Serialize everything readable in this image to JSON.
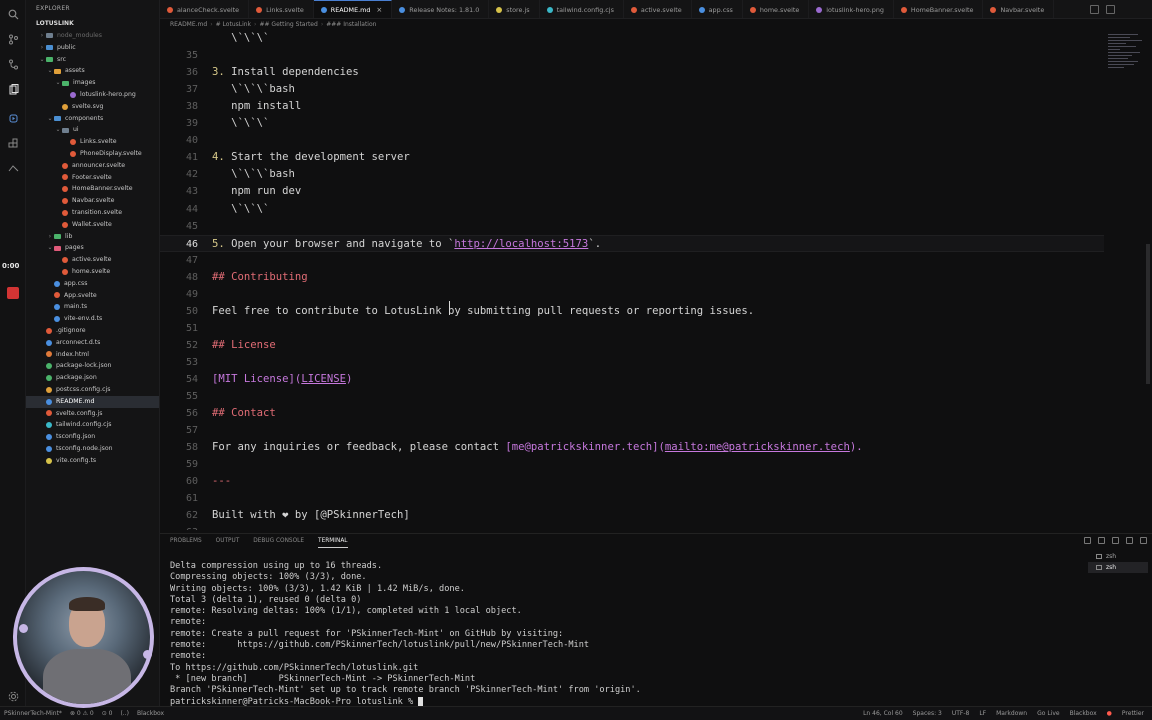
{
  "tabs": [
    {
      "label": "alanceCheck.svelte",
      "color": "#e05a3a",
      "active": false
    },
    {
      "label": "Links.svelte",
      "color": "#e05a3a",
      "active": false
    },
    {
      "label": "README.md",
      "color": "#4a8fe0",
      "active": true
    },
    {
      "label": "Release Notes: 1.81.0",
      "color": "#4a8fe0",
      "active": false
    },
    {
      "label": "store.js",
      "color": "#d6c24a",
      "active": false
    },
    {
      "label": "tailwind.config.cjs",
      "color": "#3ab8c8",
      "active": false
    },
    {
      "label": "active.svelte",
      "color": "#e05a3a",
      "active": false
    },
    {
      "label": "app.css",
      "color": "#4a8fe0",
      "active": false
    },
    {
      "label": "home.svelte",
      "color": "#e05a3a",
      "active": false
    },
    {
      "label": "lotuslink-hero.png",
      "color": "#9a6ad0",
      "active": false
    },
    {
      "label": "HomeBanner.svelte",
      "color": "#e05a3a",
      "active": false
    },
    {
      "label": "Navbar.svelte",
      "color": "#e05a3a",
      "active": false
    }
  ],
  "breadcrumb": [
    "README.md",
    "# LotusLink",
    "## Getting Started",
    "### Installation"
  ],
  "sidebar": {
    "header": "EXPLORER",
    "project": "LOTUSLINK",
    "items": [
      {
        "label": "node_modules",
        "indent": 1,
        "kind": "folder",
        "chev": "›",
        "dim": true,
        "color": "#6f7f8f"
      },
      {
        "label": "public",
        "indent": 1,
        "kind": "folder",
        "chev": "›",
        "color": "#4b8fd1"
      },
      {
        "label": "src",
        "indent": 1,
        "kind": "folder",
        "chev": "⌄",
        "color": "#4bb36a"
      },
      {
        "label": "assets",
        "indent": 2,
        "kind": "folder",
        "chev": "⌄",
        "color": "#e0a03a"
      },
      {
        "label": "images",
        "indent": 3,
        "kind": "folder",
        "chev": "⌄",
        "color": "#4bb36a"
      },
      {
        "label": "lotuslink-hero.png",
        "indent": 4,
        "kind": "file",
        "color": "#9a6ad0"
      },
      {
        "label": "svelte.svg",
        "indent": 3,
        "kind": "file",
        "color": "#e0a03a"
      },
      {
        "label": "components",
        "indent": 2,
        "kind": "folder",
        "chev": "⌄",
        "color": "#4b8fd1"
      },
      {
        "label": "ui",
        "indent": 3,
        "kind": "folder",
        "chev": "⌄",
        "color": "#6f7f8f"
      },
      {
        "label": "Links.svelte",
        "indent": 4,
        "kind": "file",
        "color": "#e05a3a"
      },
      {
        "label": "PhoneDisplay.svelte",
        "indent": 4,
        "kind": "file",
        "color": "#e05a3a"
      },
      {
        "label": "announcer.svelte",
        "indent": 3,
        "kind": "file",
        "color": "#e05a3a"
      },
      {
        "label": "Footer.svelte",
        "indent": 3,
        "kind": "file",
        "color": "#e05a3a"
      },
      {
        "label": "HomeBanner.svelte",
        "indent": 3,
        "kind": "file",
        "color": "#e05a3a"
      },
      {
        "label": "Navbar.svelte",
        "indent": 3,
        "kind": "file",
        "color": "#e05a3a"
      },
      {
        "label": "transition.svelte",
        "indent": 3,
        "kind": "file",
        "color": "#e05a3a"
      },
      {
        "label": "Wallet.svelte",
        "indent": 3,
        "kind": "file",
        "color": "#e05a3a"
      },
      {
        "label": "lib",
        "indent": 2,
        "kind": "folder",
        "chev": "›",
        "color": "#4bb36a"
      },
      {
        "label": "pages",
        "indent": 2,
        "kind": "folder",
        "chev": "⌄",
        "color": "#e05a7a"
      },
      {
        "label": "active.svelte",
        "indent": 3,
        "kind": "file",
        "color": "#e05a3a"
      },
      {
        "label": "home.svelte",
        "indent": 3,
        "kind": "file",
        "color": "#e05a3a"
      },
      {
        "label": "app.css",
        "indent": 2,
        "kind": "file",
        "color": "#4a8fe0"
      },
      {
        "label": "App.svelte",
        "indent": 2,
        "kind": "file",
        "color": "#e05a3a"
      },
      {
        "label": "main.ts",
        "indent": 2,
        "kind": "file",
        "color": "#4a8fe0"
      },
      {
        "label": "vite-env.d.ts",
        "indent": 2,
        "kind": "file",
        "color": "#4a8fe0"
      },
      {
        "label": ".gitignore",
        "indent": 1,
        "kind": "file",
        "color": "#e05a3a"
      },
      {
        "label": "arconnect.d.ts",
        "indent": 1,
        "kind": "file",
        "color": "#4a8fe0"
      },
      {
        "label": "index.html",
        "indent": 1,
        "kind": "file",
        "color": "#e07a3a"
      },
      {
        "label": "package-lock.json",
        "indent": 1,
        "kind": "file",
        "color": "#4bb36a"
      },
      {
        "label": "package.json",
        "indent": 1,
        "kind": "file",
        "color": "#4bb36a"
      },
      {
        "label": "postcss.config.cjs",
        "indent": 1,
        "kind": "file",
        "color": "#e0a03a"
      },
      {
        "label": "README.md",
        "indent": 1,
        "kind": "file",
        "color": "#4a8fe0",
        "active": true
      },
      {
        "label": "svelte.config.js",
        "indent": 1,
        "kind": "file",
        "color": "#e05a3a"
      },
      {
        "label": "tailwind.config.cjs",
        "indent": 1,
        "kind": "file",
        "color": "#3ab8c8"
      },
      {
        "label": "tsconfig.json",
        "indent": 1,
        "kind": "file",
        "color": "#4a8fe0"
      },
      {
        "label": "tsconfig.node.json",
        "indent": 1,
        "kind": "file",
        "color": "#4a8fe0"
      },
      {
        "label": "vite.config.ts",
        "indent": 1,
        "kind": "file",
        "color": "#d6c24a"
      }
    ]
  },
  "activity": {
    "timer": "0:00"
  },
  "editor": {
    "current_line": "46",
    "lines": [
      {
        "n": "",
        "segs": [
          {
            "t": "   \\`\\`\\`",
            "c": "md-code"
          }
        ]
      },
      {
        "n": "35",
        "segs": []
      },
      {
        "n": "36",
        "segs": [
          {
            "t": "3.",
            "c": "md-num"
          },
          {
            "t": " Install dependencies"
          }
        ]
      },
      {
        "n": "37",
        "segs": [
          {
            "t": "   \\`\\`\\`bash",
            "c": "md-code"
          }
        ]
      },
      {
        "n": "38",
        "segs": [
          {
            "t": "   npm install"
          }
        ]
      },
      {
        "n": "39",
        "segs": [
          {
            "t": "   \\`\\`\\`",
            "c": "md-code"
          }
        ]
      },
      {
        "n": "40",
        "segs": []
      },
      {
        "n": "41",
        "segs": [
          {
            "t": "4.",
            "c": "md-num"
          },
          {
            "t": " Start the development server"
          }
        ]
      },
      {
        "n": "42",
        "segs": [
          {
            "t": "   \\`\\`\\`bash",
            "c": "md-code"
          }
        ]
      },
      {
        "n": "43",
        "segs": [
          {
            "t": "   npm run dev"
          }
        ]
      },
      {
        "n": "44",
        "segs": [
          {
            "t": "   \\`\\`\\`",
            "c": "md-code"
          }
        ]
      },
      {
        "n": "45",
        "segs": []
      },
      {
        "n": "46",
        "segs": [
          {
            "t": "5.",
            "c": "md-num"
          },
          {
            "t": " Open your browser and navigate to `"
          },
          {
            "t": "http://localhost:5173",
            "c": "md-url"
          },
          {
            "t": "`."
          }
        ]
      },
      {
        "n": "47",
        "segs": []
      },
      {
        "n": "48",
        "segs": [
          {
            "t": "## Contributing",
            "c": "md-head"
          }
        ]
      },
      {
        "n": "49",
        "segs": []
      },
      {
        "n": "50",
        "segs": [
          {
            "t": "Feel free to contribute to LotusLink by submitting pull requests or reporting issues."
          }
        ]
      },
      {
        "n": "51",
        "segs": []
      },
      {
        "n": "52",
        "segs": [
          {
            "t": "## License",
            "c": "md-head"
          }
        ]
      },
      {
        "n": "53",
        "segs": []
      },
      {
        "n": "54",
        "segs": [
          {
            "t": "[MIT License]",
            "c": "md-link"
          },
          {
            "t": "(",
            "c": "md-link"
          },
          {
            "t": "LICENSE",
            "c": "md-url"
          },
          {
            "t": ")",
            "c": "md-link"
          }
        ]
      },
      {
        "n": "55",
        "segs": []
      },
      {
        "n": "56",
        "segs": [
          {
            "t": "## Contact",
            "c": "md-head"
          }
        ]
      },
      {
        "n": "57",
        "segs": []
      },
      {
        "n": "58",
        "segs": [
          {
            "t": "For any inquiries or feedback, please contact "
          },
          {
            "t": "[me@patrickskinner.tech]",
            "c": "md-link"
          },
          {
            "t": "(",
            "c": "md-link"
          },
          {
            "t": "mailto:me@patrickskinner.tech",
            "c": "md-url"
          },
          {
            "t": ").",
            "c": "md-link"
          }
        ]
      },
      {
        "n": "59",
        "segs": []
      },
      {
        "n": "60",
        "segs": [
          {
            "t": "---",
            "c": "md-hr"
          }
        ]
      },
      {
        "n": "61",
        "segs": []
      },
      {
        "n": "62",
        "segs": [
          {
            "t": "Built with ❤ by [@PSkinnerTech]"
          }
        ]
      },
      {
        "n": "63",
        "segs": []
      }
    ]
  },
  "panel": {
    "tabs": [
      "PROBLEMS",
      "OUTPUT",
      "DEBUG CONSOLE",
      "TERMINAL"
    ],
    "active_tab": "TERMINAL",
    "shells": [
      "zsh",
      "zsh"
    ],
    "terminal_lines": [
      "Delta compression using up to 16 threads.",
      "Compressing objects: 100% (3/3), done.",
      "Writing objects: 100% (3/3), 1.42 KiB | 1.42 MiB/s, done.",
      "Total 3 (delta 1), reused 0 (delta 0)",
      "remote: Resolving deltas: 100% (1/1), completed with 1 local object.",
      "remote:",
      "remote: Create a pull request for 'PSkinnerTech-Mint' on GitHub by visiting:",
      "remote:      https://github.com/PSkinnerTech/lotuslink/pull/new/PSkinnerTech-Mint",
      "remote:",
      "To https://github.com/PSkinnerTech/lotuslink.git",
      " * [new branch]      PSkinnerTech-Mint -> PSkinnerTech-Mint",
      "Branch 'PSkinnerTech-Mint' set up to track remote branch 'PSkinnerTech-Mint' from 'origin'."
    ],
    "prompt": "patrickskinner@Patricks-MacBook-Pro lotuslink % "
  },
  "status": {
    "left": [
      "PSkinnerTech-Mint*",
      "⊗ 0 ⚠ 0",
      "⊙ 0",
      "(..)",
      "Blackbox"
    ],
    "right": [
      "Ln 46, Col 60",
      "Spaces: 3",
      "UTF-8",
      "LF",
      "Markdown",
      "Go Live",
      "Blackbox",
      "●",
      "Prettier"
    ]
  }
}
